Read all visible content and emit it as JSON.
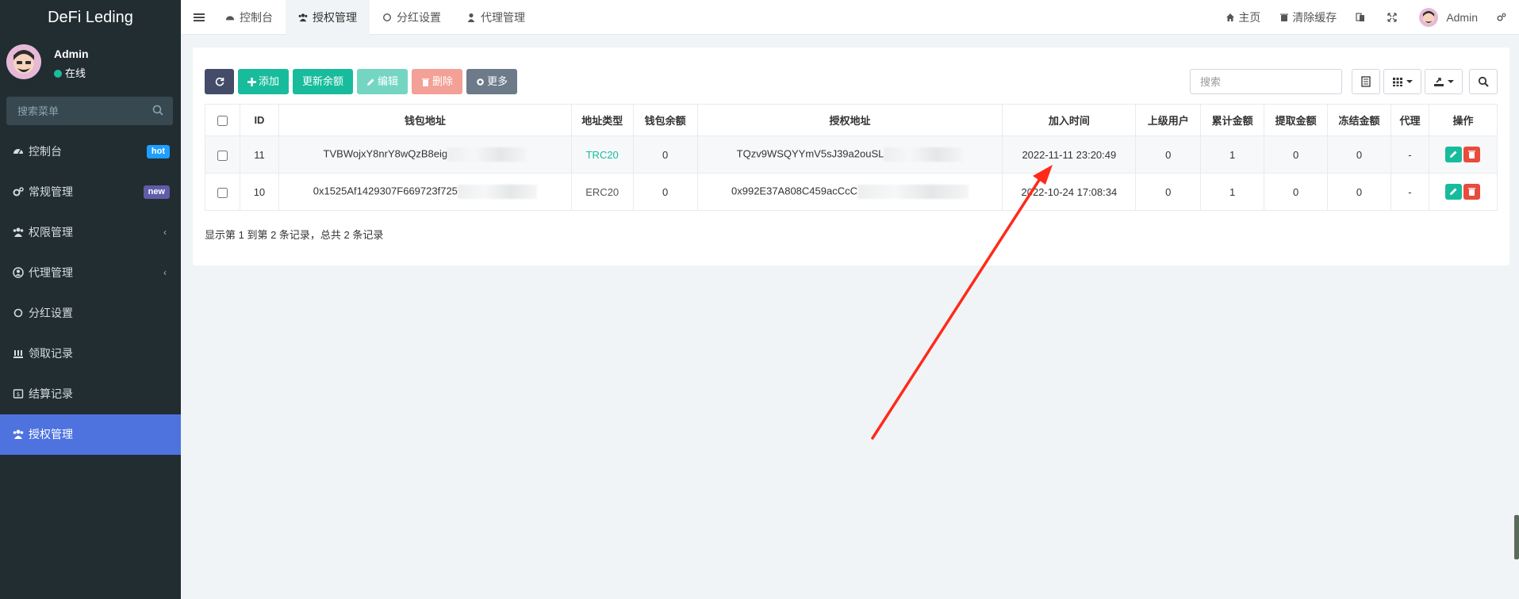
{
  "sidebar": {
    "brand": "DeFi Leding",
    "user": {
      "name": "Admin",
      "status": "在线"
    },
    "search_placeholder": "搜索菜单",
    "items": [
      {
        "label": "控制台",
        "icon": "dashboard-icon",
        "badge": "hot"
      },
      {
        "label": "常规管理",
        "icon": "cogs-icon",
        "badge": "new"
      },
      {
        "label": "权限管理",
        "icon": "group-icon",
        "chevron": "‹"
      },
      {
        "label": "代理管理",
        "icon": "user-circle-icon",
        "chevron": "‹"
      },
      {
        "label": "分红设置",
        "icon": "circle-icon"
      },
      {
        "label": "领取记录",
        "icon": "list-icon"
      },
      {
        "label": "结算记录",
        "icon": "calculator-icon"
      },
      {
        "label": "授权管理",
        "icon": "group-icon",
        "active": true
      }
    ]
  },
  "topbar": {
    "tabs": [
      {
        "label": "控制台",
        "icon": "dashboard-icon"
      },
      {
        "label": "授权管理",
        "icon": "group-icon",
        "active": true
      },
      {
        "label": "分红设置",
        "icon": "circle-icon"
      },
      {
        "label": "代理管理",
        "icon": "user-icon"
      }
    ],
    "right": {
      "home": "主页",
      "clear_cache": "清除缓存",
      "admin": "Admin"
    }
  },
  "toolbar": {
    "add": "添加",
    "update_balance": "更新余额",
    "edit": "编辑",
    "delete": "删除",
    "more": "更多",
    "search_placeholder": "搜索"
  },
  "table": {
    "headers": [
      "ID",
      "钱包地址",
      "地址类型",
      "钱包余额",
      "授权地址",
      "加入时间",
      "上级用户",
      "累计金额",
      "提取金额",
      "冻结金额",
      "代理",
      "操作"
    ],
    "rows": [
      {
        "id": "11",
        "wallet": "TVBWojxY8nrY8wQzB8eig",
        "type": "TRC20",
        "balance": "0",
        "auth": "TQzv9WSQYYmV5sJ39a2ouSL",
        "time": "2022-11-11 23:20:49",
        "parent": "0",
        "total": "1",
        "withdraw": "0",
        "frozen": "0",
        "agent": "-"
      },
      {
        "id": "10",
        "wallet": "0x1525Af1429307F669723f725",
        "type": "ERC20",
        "balance": "0",
        "auth": "0x992E37A808C459acCcC",
        "time": "2022-10-24 17:08:34",
        "parent": "0",
        "total": "1",
        "withdraw": "0",
        "frozen": "0",
        "agent": "-"
      }
    ]
  },
  "pager": {
    "summary": "显示第 1 到第 2 条记录，总共 2 条记录"
  },
  "colors": {
    "accent": "#4e73df",
    "success": "#18bc9c",
    "danger": "#e74c3c",
    "sidebar": "#222d32",
    "arrow": "#ff2a1a"
  }
}
